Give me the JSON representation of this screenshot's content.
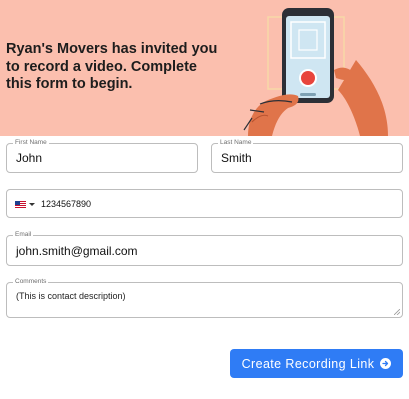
{
  "banner": {
    "heading": "Ryan's Movers has invited you to record a video. Complete this form to begin."
  },
  "form": {
    "first_name": {
      "label": "First Name",
      "value": "John"
    },
    "last_name": {
      "label": "Last Name",
      "value": "Smith"
    },
    "phone": {
      "country_icon": "us-flag-icon",
      "value": "1234567890"
    },
    "email": {
      "label": "Email",
      "value": "john.smith@gmail.com"
    },
    "comments": {
      "label": "Comments",
      "value": "(This is contact description)"
    }
  },
  "actions": {
    "create_label": "Create Recording Link",
    "create_icon": "arrow-right-circle-icon"
  },
  "colors": {
    "banner_bg": "#fbbfae",
    "primary_button": "#2f7cf5"
  }
}
